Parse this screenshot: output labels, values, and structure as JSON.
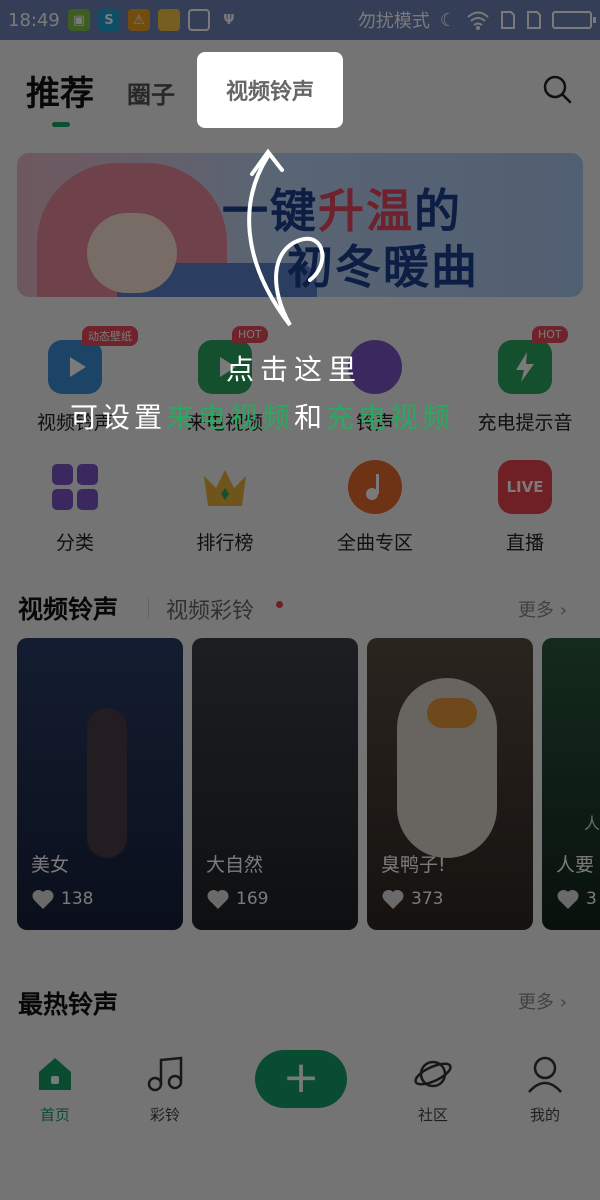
{
  "status_bar": {
    "time": "18:49",
    "dnd_label": "勿扰模式",
    "icons": [
      "app-icon",
      "app-icon",
      "warning-icon",
      "folder-icon",
      "cleaner-icon",
      "usb-icon"
    ]
  },
  "top_tabs": {
    "recommend": "推荐",
    "circle": "圈子",
    "video_ringtone": "视频铃声"
  },
  "banner": {
    "line1_a": "一键",
    "line1_hot": "升温",
    "line1_b": "的",
    "line2": "初冬暖曲"
  },
  "features_row1": [
    {
      "label": "视频铃声",
      "badge": "动态壁纸",
      "icon": "video-icon",
      "color": "#3a8fd8"
    },
    {
      "label": "来电视频",
      "badge": "HOT",
      "icon": "phone-video-icon",
      "color": "#2aa860"
    },
    {
      "label": "铃声",
      "badge": "",
      "icon": "grape-icon",
      "color": "#7b55c4"
    },
    {
      "label": "充电提示音",
      "badge": "HOT",
      "icon": "charge-icon",
      "color": "#2aa860"
    }
  ],
  "features_row2": [
    {
      "label": "分类",
      "icon": "category-icon",
      "color": "#7b55c4"
    },
    {
      "label": "排行榜",
      "icon": "crown-icon",
      "color": "#e8b23c"
    },
    {
      "label": "全曲专区",
      "icon": "music-disc-icon",
      "color": "#e66a2c"
    },
    {
      "label": "直播",
      "icon": "live-icon",
      "color": "#e8434f",
      "icon_text": "LIVE"
    }
  ],
  "video_section": {
    "title": "视频铃声",
    "subtitle": "视频彩铃",
    "more": "更多 ›",
    "cards": [
      {
        "title": "美女",
        "likes": "138",
        "color": "#1f2c4a"
      },
      {
        "title": "大自然",
        "likes": "169",
        "color": "#2b2e33"
      },
      {
        "title": "臭鸭子!",
        "likes": "373",
        "color": "#3a3632"
      },
      {
        "title": "人要",
        "likes": "3",
        "color": "#1e3a28",
        "overlay_text": "人"
      }
    ]
  },
  "hot_section": {
    "title": "最热铃声",
    "more": "更多 ›"
  },
  "bottom_nav": {
    "items": [
      {
        "label": "首页",
        "icon": "home-icon"
      },
      {
        "label": "彩铃",
        "icon": "music-note-icon"
      },
      {
        "label": "社区",
        "icon": "planet-icon"
      },
      {
        "label": "我的",
        "icon": "profile-icon"
      }
    ],
    "add_label": "+"
  },
  "guide": {
    "line1": "点击这里",
    "line2_a": "可设置",
    "line2_green1": "来电视频",
    "line2_b": "和",
    "line2_green2": "充电视频"
  }
}
